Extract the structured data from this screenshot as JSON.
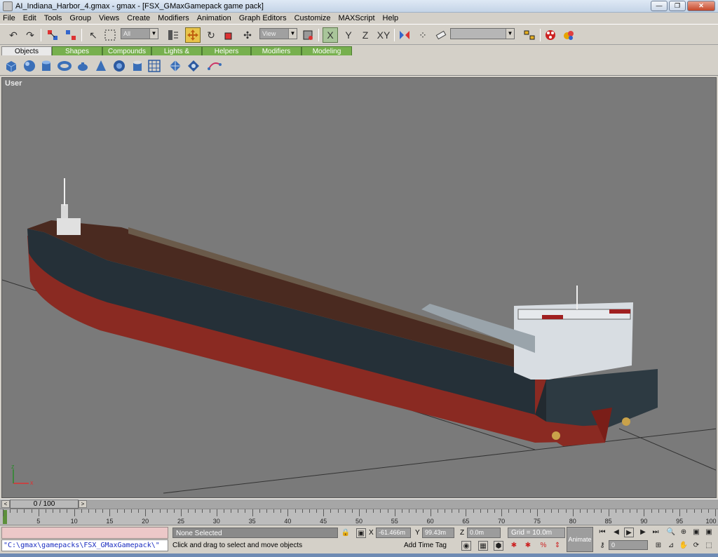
{
  "window": {
    "title": "AI_Indiana_Harbor_4.gmax - gmax - [FSX_GMaxGamepack game pack]",
    "minimize": "—",
    "restore": "❐",
    "close": "✕"
  },
  "menu": [
    "File",
    "Edit",
    "Tools",
    "Group",
    "Views",
    "Create",
    "Modifiers",
    "Animation",
    "Graph Editors",
    "Customize",
    "MAXScript",
    "Help"
  ],
  "toolbar": {
    "selection_filter": "All",
    "ref_coord": "View",
    "named_selection": "",
    "axis_x": "X",
    "axis_y": "Y",
    "axis_z": "Z",
    "axis_xy": "XY"
  },
  "create_tabs": [
    "Objects",
    "Shapes",
    "Compounds",
    "Lights & Cameras",
    "Helpers",
    "Modifiers",
    "Modeling"
  ],
  "viewport": {
    "label": "User"
  },
  "time_slider": {
    "position": "0 / 100",
    "prev": "<",
    "next": ">"
  },
  "track_labels": [
    "5",
    "10",
    "15",
    "20",
    "25",
    "30",
    "35",
    "40",
    "45",
    "50",
    "55",
    "60",
    "65",
    "70",
    "75",
    "80",
    "85",
    "90",
    "95",
    "100"
  ],
  "status": {
    "maxscript_input": "",
    "maxscript_output": "\"C:\\gmax\\gamepacks\\FSX_GMaxGamepack\\\"",
    "selection": "None Selected",
    "prompt": "Click and drag to select and move objects",
    "x_label": "X",
    "x_value": "-61.466m",
    "y_label": "Y",
    "y_value": "99.43m",
    "z_label": "Z",
    "z_value": "0.0m",
    "grid": "Grid = 10.0m",
    "add_time_tag": "Add Time Tag",
    "animate": "Animate",
    "frame": "0"
  },
  "axis_gizmo": {
    "x": "x",
    "z": "z"
  }
}
